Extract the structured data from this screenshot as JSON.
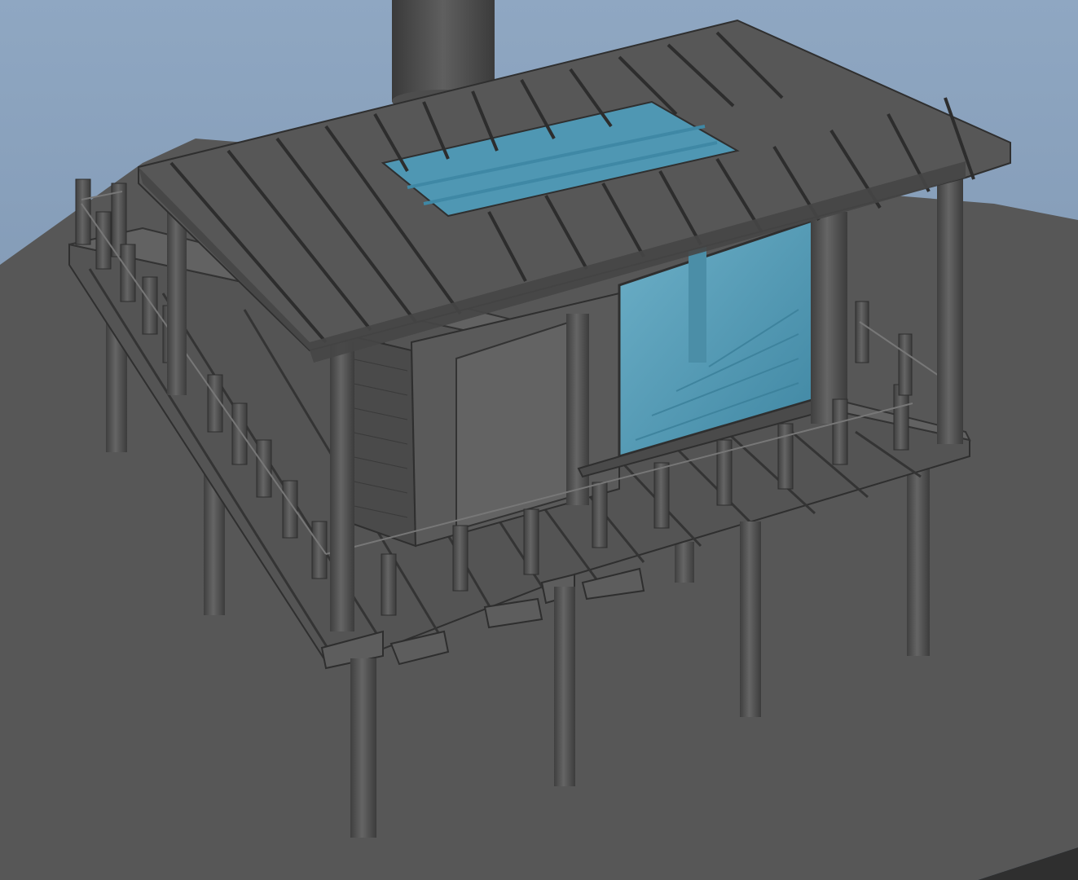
{
  "viewport": {
    "background_top": "#8ba2bd",
    "background_bottom": "#5f7590",
    "ground_color": "#575757",
    "selection_tint": "#4f97b3",
    "wood_dark": "#3a3a3a",
    "wood_mid": "#555555",
    "wood_light": "#676767",
    "icons": [
      "stilt-house-model",
      "chimney-pipe",
      "roof-planks",
      "deck-planks",
      "rail-posts",
      "glass-walls",
      "support-stilts"
    ]
  }
}
